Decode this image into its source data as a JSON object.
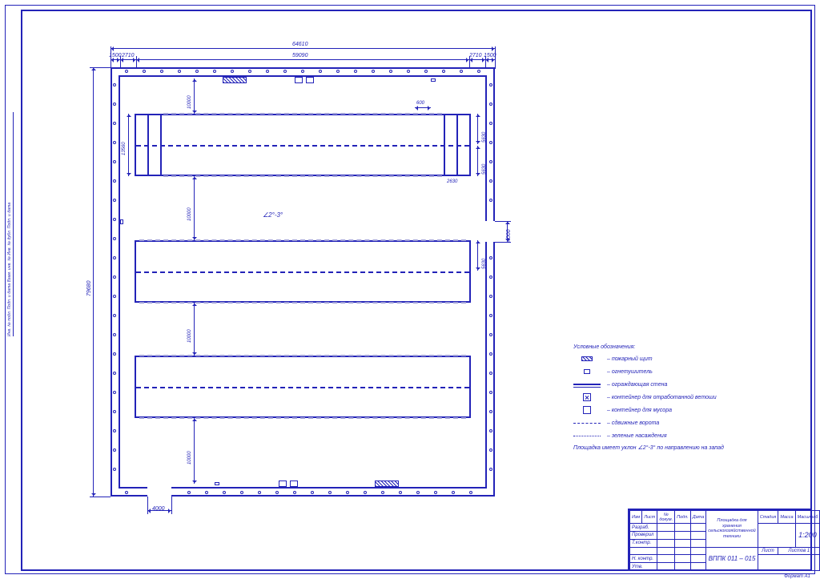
{
  "dims": {
    "total_width": "64610",
    "inner_width": "59090",
    "margin_lr": "1500",
    "offset_side": "2710",
    "total_height": "79680",
    "row_spacing_top": "10000",
    "row_spacing_mid1": "10000",
    "row_spacing_mid2": "10000",
    "row_spacing_bot": "10000",
    "bay_height": "13560",
    "section_w": "600",
    "section_h": "5630",
    "gate_bot": "4000",
    "detail_r": "2630",
    "gate_right": "4000"
  },
  "slope": "∠2°-3°",
  "legend": {
    "title": "Условные обозначения:",
    "items": [
      {
        "sym": "box-filled",
        "text": "– пожарный щит"
      },
      {
        "sym": "d",
        "text": "– огнетушитель"
      },
      {
        "sym": "lines",
        "text": "– ограждающая стена"
      },
      {
        "sym": "box-x",
        "text": "– контейнер для отработанной ветоши"
      },
      {
        "sym": "box-empty",
        "text": "– контейнер для мусора"
      },
      {
        "sym": "dash",
        "text": "– сдвижные ворота"
      },
      {
        "sym": "dots",
        "text": "– зеленые насаждения"
      }
    ],
    "note": "Площадка имеет уклон ∠2°-3° по направлению на запад"
  },
  "titleblock": {
    "head": [
      "Изм",
      "Лист",
      "№ докум.",
      "Подп.",
      "Дата"
    ],
    "rows": [
      "Разраб.",
      "Проверил",
      "Т.контр.",
      "",
      "Н. контр.",
      "Утв."
    ],
    "top_labels": [
      "Стадия",
      "Масса",
      "Масштаб"
    ],
    "title_line1": "Площадка для хранения",
    "title_line2": "сельскохозяйственной техники",
    "scale": "1:200",
    "sheet_labels": [
      "Лист",
      "Листов  1"
    ],
    "code": "ВППК 011 – 015",
    "format": "Формат        А1"
  },
  "side_label": "Инв. № подл.   Подп. и дата   Взам. инв. №   Инв. № дубл.   Подп. и дата"
}
